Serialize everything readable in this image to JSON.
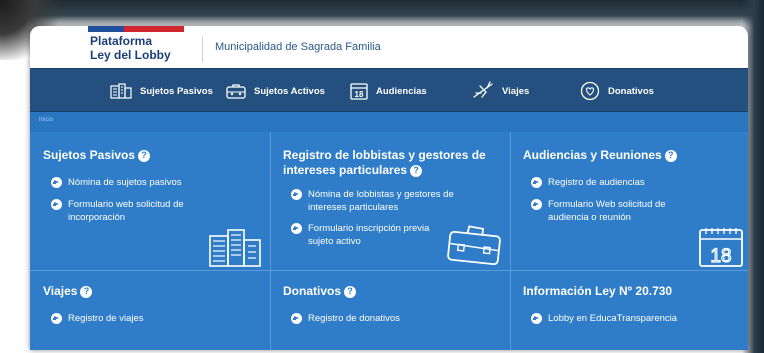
{
  "header": {
    "logo_line1": "Plataforma",
    "logo_line2": "Ley del Lobby",
    "municipality": "Municipalidad de Sagrada Familia"
  },
  "nav": {
    "items": [
      {
        "label": "Sujetos Pasivos",
        "icon": "buildings-icon"
      },
      {
        "label": "Sujetos Activos",
        "icon": "briefcase-icon"
      },
      {
        "label": "Audiencias",
        "icon": "calendar-icon"
      },
      {
        "label": "Viajes",
        "icon": "airplane-icon"
      },
      {
        "label": "Donativos",
        "icon": "gift-icon"
      }
    ]
  },
  "breadcrumb": "Inicio",
  "cards": [
    {
      "title": "Sujetos Pasivos",
      "links": [
        "Nómina de sujetos pasivos",
        "Formulario web solicitud de incorporación"
      ],
      "icon": "buildings-icon"
    },
    {
      "title": "Registro de lobbistas y gestores de intereses particulares",
      "links": [
        "Nómina de lobbistas y gestores de intereses particulares",
        "Formulario inscripción previa sujeto activo"
      ],
      "icon": "briefcase-icon"
    },
    {
      "title": "Audiencias y Reuniones",
      "links": [
        "Registro de audiencias",
        "Formulario Web solicitud de audiencia o reunión"
      ],
      "icon": "calendar-icon",
      "calendar_day": "18"
    },
    {
      "title": "Viajes",
      "links": [
        "Registro de viajes"
      ]
    },
    {
      "title": "Donativos",
      "links": [
        "Registro de donativos"
      ]
    },
    {
      "title": "Información Ley Nº 20.730",
      "links": [
        "Lobby en EducaTransparencia"
      ]
    }
  ],
  "colors": {
    "nav_bg": "#24507f",
    "grid_bg": "#2f7dc8",
    "brand_dark": "#1b3f7a",
    "flag_red": "#d3262f"
  }
}
